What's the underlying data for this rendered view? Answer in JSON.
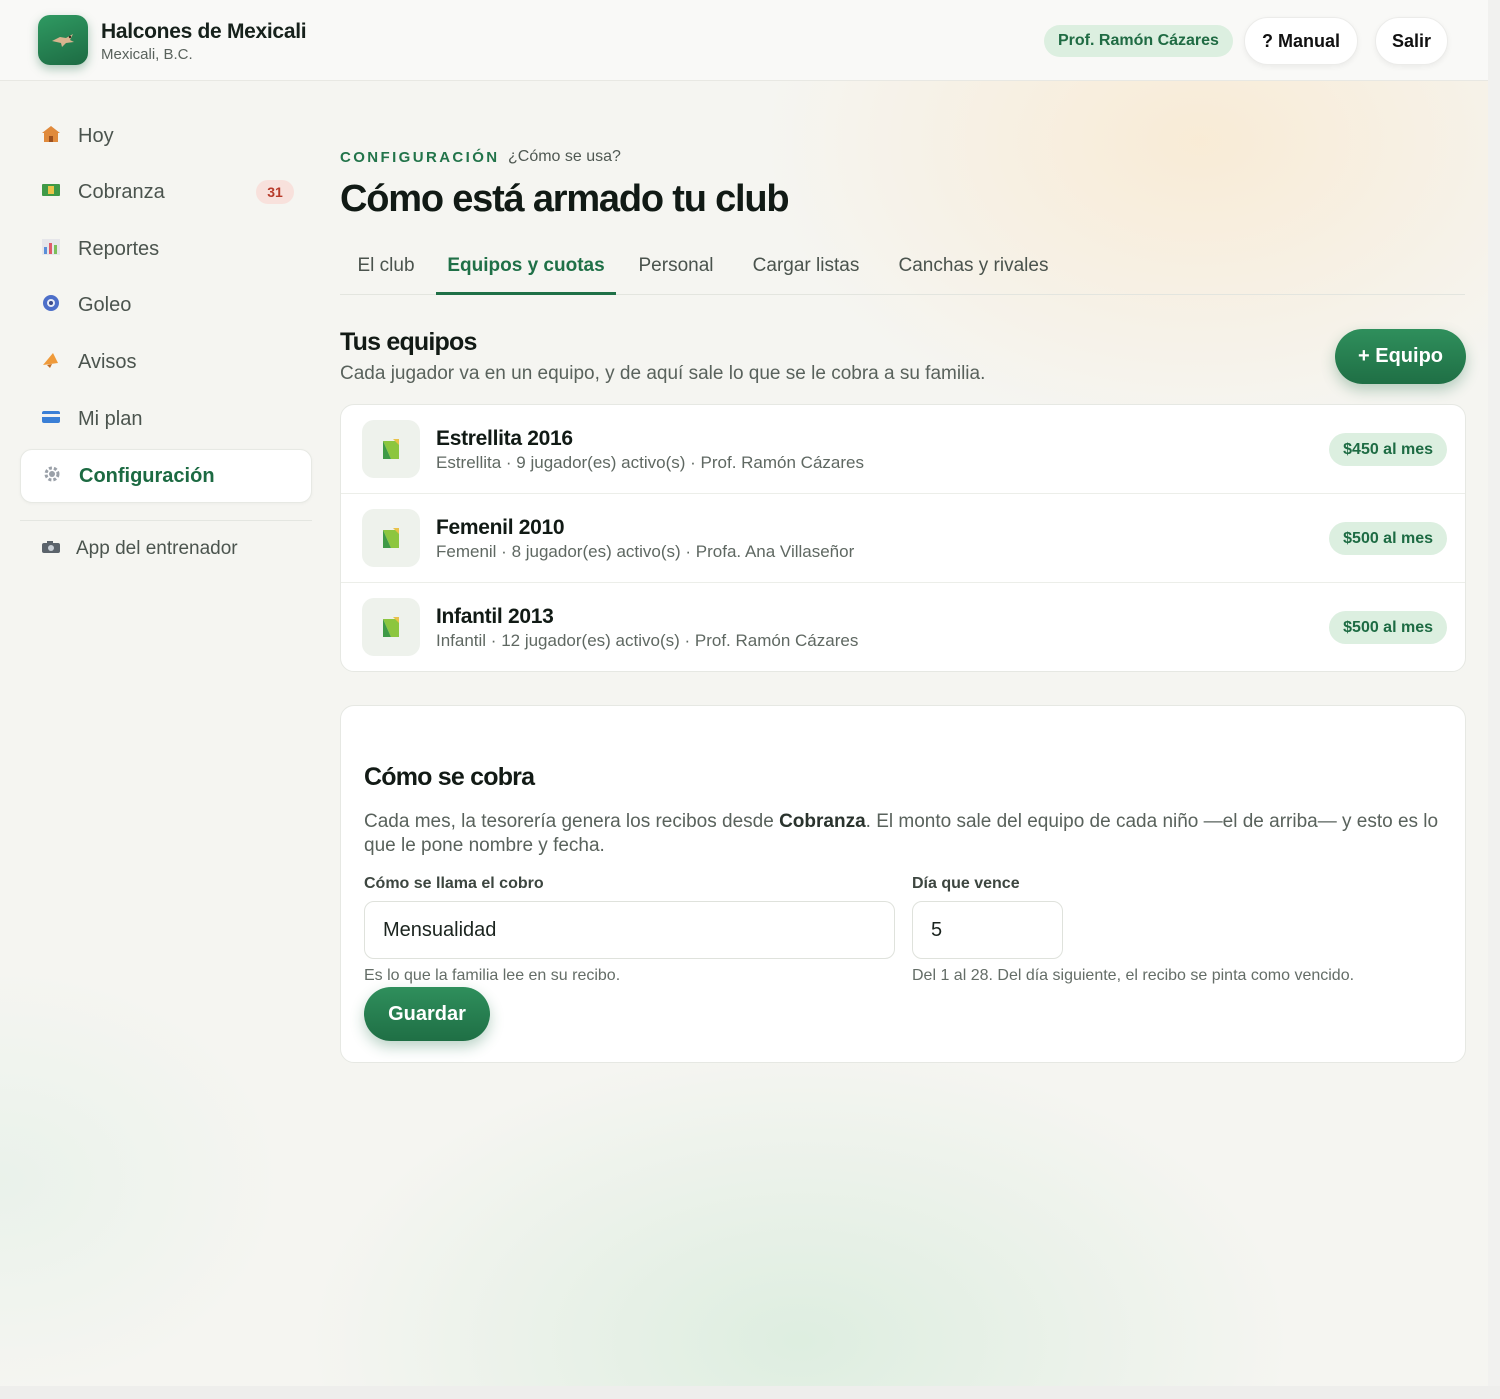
{
  "header": {
    "club_name": "Halcones de Mexicali",
    "club_city": "Mexicali, B.C.",
    "user": "Prof. Ramón Cázares",
    "manual_label": "? Manual",
    "logout_label": "Salir"
  },
  "sidebar": {
    "items": [
      {
        "label": "Hoy",
        "icon": "house-icon"
      },
      {
        "label": "Cobranza",
        "icon": "money-icon",
        "badge": "31"
      },
      {
        "label": "Reportes",
        "icon": "bar-chart-icon"
      },
      {
        "label": "Goleo",
        "icon": "soccer-ball-icon"
      },
      {
        "label": "Avisos",
        "icon": "megaphone-icon"
      },
      {
        "label": "Mi plan",
        "icon": "credit-card-icon"
      },
      {
        "label": "Configuración",
        "icon": "gear-icon"
      }
    ],
    "coach_app_label": "App del entrenador"
  },
  "main": {
    "eyebrow": "CONFIGURACIÓN",
    "help_link": "¿Cómo se usa?",
    "title": "Cómo está armado tu club",
    "tabs": [
      {
        "label": "El club"
      },
      {
        "label": "Equipos y cuotas",
        "active": true
      },
      {
        "label": "Personal"
      },
      {
        "label": "Cargar listas"
      },
      {
        "label": "Canchas y rivales"
      }
    ],
    "teams_section": {
      "title": "Tus equipos",
      "subtitle": "Cada jugador va en un equipo, y de aquí sale lo que se le cobra a su familia.",
      "add_button": "+ Equipo",
      "teams": [
        {
          "name": "Estrellita 2016",
          "meta": "Estrellita · 9 jugador(es) activo(s) · Prof. Ramón Cázares",
          "fee": "$450 al mes"
        },
        {
          "name": "Femenil 2010",
          "meta": "Femenil · 8 jugador(es) activo(s) · Profa. Ana Villaseñor",
          "fee": "$500 al mes"
        },
        {
          "name": "Infantil 2013",
          "meta": "Infantil · 12 jugador(es) activo(s) · Prof. Ramón Cázares",
          "fee": "$500 al mes"
        }
      ]
    },
    "billing_section": {
      "title": "Cómo se cobra",
      "text_before": "Cada mes, la tesorería genera los recibos desde ",
      "text_bold": "Cobranza",
      "text_after": ". El monto sale del equipo de cada niño —el de arriba— y esto es lo que le pone nombre y fecha.",
      "name_label": "Cómo se llama el cobro",
      "name_value": "Mensualidad",
      "name_hint": "Es lo que la familia lee en su recibo.",
      "due_label": "Día que vence",
      "due_value": "5",
      "due_hint": "Del 1 al 28. Del día siguiente, el recibo se pinta como vencido.",
      "save_label": "Guardar"
    }
  },
  "colors": {
    "accent": "#1f7047",
    "pill_bg": "#dcefe0",
    "badge_bg": "#f8e1dc",
    "badge_text": "#b73b2a"
  }
}
